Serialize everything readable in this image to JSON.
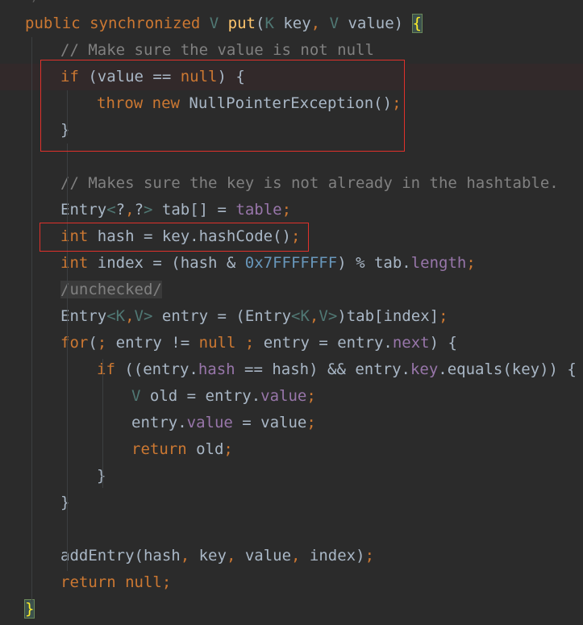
{
  "code_lines": [
    {
      "tokens": [
        {
          "c": "t-kw",
          "t": "public synchronized "
        },
        {
          "c": "t-ty",
          "t": "V "
        },
        {
          "c": "t-fn",
          "t": "put"
        },
        {
          "c": "t-pl",
          "t": "("
        },
        {
          "c": "t-ty",
          "t": "K "
        },
        {
          "c": "t-pl",
          "t": "key"
        },
        {
          "c": "t-kw",
          "t": ", "
        },
        {
          "c": "t-ty",
          "t": "V "
        },
        {
          "c": "t-pl",
          "t": "value) "
        },
        {
          "c": "t-brace",
          "t": "{"
        }
      ]
    },
    {
      "tokens": [
        {
          "c": "t-cm",
          "t": "// Make sure the value is not null"
        }
      ]
    },
    {
      "tokens": [
        {
          "c": "t-kw",
          "t": "if "
        },
        {
          "c": "t-pl",
          "t": "(value == "
        },
        {
          "c": "t-kw",
          "t": "null"
        },
        {
          "c": "t-pl",
          "t": ") {"
        }
      ]
    },
    {
      "tokens": [
        {
          "c": "t-kw",
          "t": "throw new "
        },
        {
          "c": "t-pl",
          "t": "NullPointerException()"
        },
        {
          "c": "t-kw",
          "t": ";"
        }
      ]
    },
    {
      "tokens": [
        {
          "c": "t-pl",
          "t": "}"
        }
      ]
    },
    {
      "tokens": []
    },
    {
      "tokens": [
        {
          "c": "t-cm",
          "t": "// Makes sure the key is not already in the hashtable."
        }
      ]
    },
    {
      "tokens": [
        {
          "c": "t-pl",
          "t": "Entry"
        },
        {
          "c": "t-ty",
          "t": "<"
        },
        {
          "c": "t-pl",
          "t": "?"
        },
        {
          "c": "t-kw",
          "t": ","
        },
        {
          "c": "t-pl",
          "t": "?"
        },
        {
          "c": "t-ty",
          "t": ">"
        },
        {
          "c": "t-pl",
          "t": " tab[] = "
        },
        {
          "c": "t-fd",
          "t": "table"
        },
        {
          "c": "t-kw",
          "t": ";"
        }
      ]
    },
    {
      "tokens": [
        {
          "c": "t-kw",
          "t": "int "
        },
        {
          "c": "t-pl",
          "t": "hash = key.hashCode()"
        },
        {
          "c": "t-kw",
          "t": ";"
        }
      ]
    },
    {
      "tokens": [
        {
          "c": "t-kw",
          "t": "int "
        },
        {
          "c": "t-pl",
          "t": "index = (hash & "
        },
        {
          "c": "t-nm",
          "t": "0x7FFFFFFF"
        },
        {
          "c": "t-pl",
          "t": ") % tab."
        },
        {
          "c": "t-fd",
          "t": "length"
        },
        {
          "c": "t-kw",
          "t": ";"
        }
      ]
    },
    {
      "tokens": [
        {
          "c": "t-sel",
          "t": "/unchecked/"
        }
      ]
    },
    {
      "tokens": [
        {
          "c": "t-pl",
          "t": "Entry"
        },
        {
          "c": "t-ty",
          "t": "<K"
        },
        {
          "c": "t-kw",
          "t": ","
        },
        {
          "c": "t-ty",
          "t": "V>"
        },
        {
          "c": "t-pl",
          "t": " entry = (Entry"
        },
        {
          "c": "t-ty",
          "t": "<K"
        },
        {
          "c": "t-kw",
          "t": ","
        },
        {
          "c": "t-ty",
          "t": "V>"
        },
        {
          "c": "t-pl",
          "t": ")tab[index]"
        },
        {
          "c": "t-kw",
          "t": ";"
        }
      ]
    },
    {
      "tokens": [
        {
          "c": "t-kw",
          "t": "for"
        },
        {
          "c": "t-pl",
          "t": "("
        },
        {
          "c": "t-kw",
          "t": "; "
        },
        {
          "c": "t-pl",
          "t": "entry != "
        },
        {
          "c": "t-kw",
          "t": "null ; "
        },
        {
          "c": "t-pl",
          "t": "entry = entry."
        },
        {
          "c": "t-fd",
          "t": "next"
        },
        {
          "c": "t-pl",
          "t": ") {"
        }
      ]
    },
    {
      "tokens": [
        {
          "c": "t-kw",
          "t": "if "
        },
        {
          "c": "t-pl",
          "t": "((entry."
        },
        {
          "c": "t-fd",
          "t": "hash"
        },
        {
          "c": "t-pl",
          "t": " == hash) && entry."
        },
        {
          "c": "t-fd",
          "t": "key"
        },
        {
          "c": "t-pl",
          "t": ".equals(key)) {"
        }
      ]
    },
    {
      "tokens": [
        {
          "c": "t-ty",
          "t": "V "
        },
        {
          "c": "t-pl",
          "t": "old = entry."
        },
        {
          "c": "t-fd",
          "t": "value"
        },
        {
          "c": "t-kw",
          "t": ";"
        }
      ]
    },
    {
      "tokens": [
        {
          "c": "t-pl",
          "t": "entry."
        },
        {
          "c": "t-fd",
          "t": "value"
        },
        {
          "c": "t-pl",
          "t": " = value"
        },
        {
          "c": "t-kw",
          "t": ";"
        }
      ]
    },
    {
      "tokens": [
        {
          "c": "t-kw",
          "t": "return "
        },
        {
          "c": "t-pl",
          "t": "old"
        },
        {
          "c": "t-kw",
          "t": ";"
        }
      ]
    },
    {
      "tokens": [
        {
          "c": "t-pl",
          "t": "}"
        }
      ]
    },
    {
      "tokens": [
        {
          "c": "t-pl",
          "t": "}"
        }
      ]
    },
    {
      "tokens": []
    },
    {
      "tokens": [
        {
          "c": "t-pl",
          "t": "addEntry(hash"
        },
        {
          "c": "t-kw",
          "t": ", "
        },
        {
          "c": "t-pl",
          "t": "key"
        },
        {
          "c": "t-kw",
          "t": ", "
        },
        {
          "c": "t-pl",
          "t": "value"
        },
        {
          "c": "t-kw",
          "t": ", "
        },
        {
          "c": "t-pl",
          "t": "index)"
        },
        {
          "c": "t-kw",
          "t": ";"
        }
      ]
    },
    {
      "tokens": [
        {
          "c": "t-kw",
          "t": "return null;"
        }
      ]
    },
    {
      "tokens": [
        {
          "c": "t-brace",
          "t": "}"
        }
      ]
    }
  ],
  "colors": {
    "background": "#2b2b2b",
    "keyword": "#cc7832",
    "comment": "#808080",
    "method": "#ffc66d",
    "type_param": "#507874",
    "field": "#9876aa",
    "number": "#6897bb",
    "plain": "#a9b7c6",
    "highlight_box": "#e0312b"
  }
}
